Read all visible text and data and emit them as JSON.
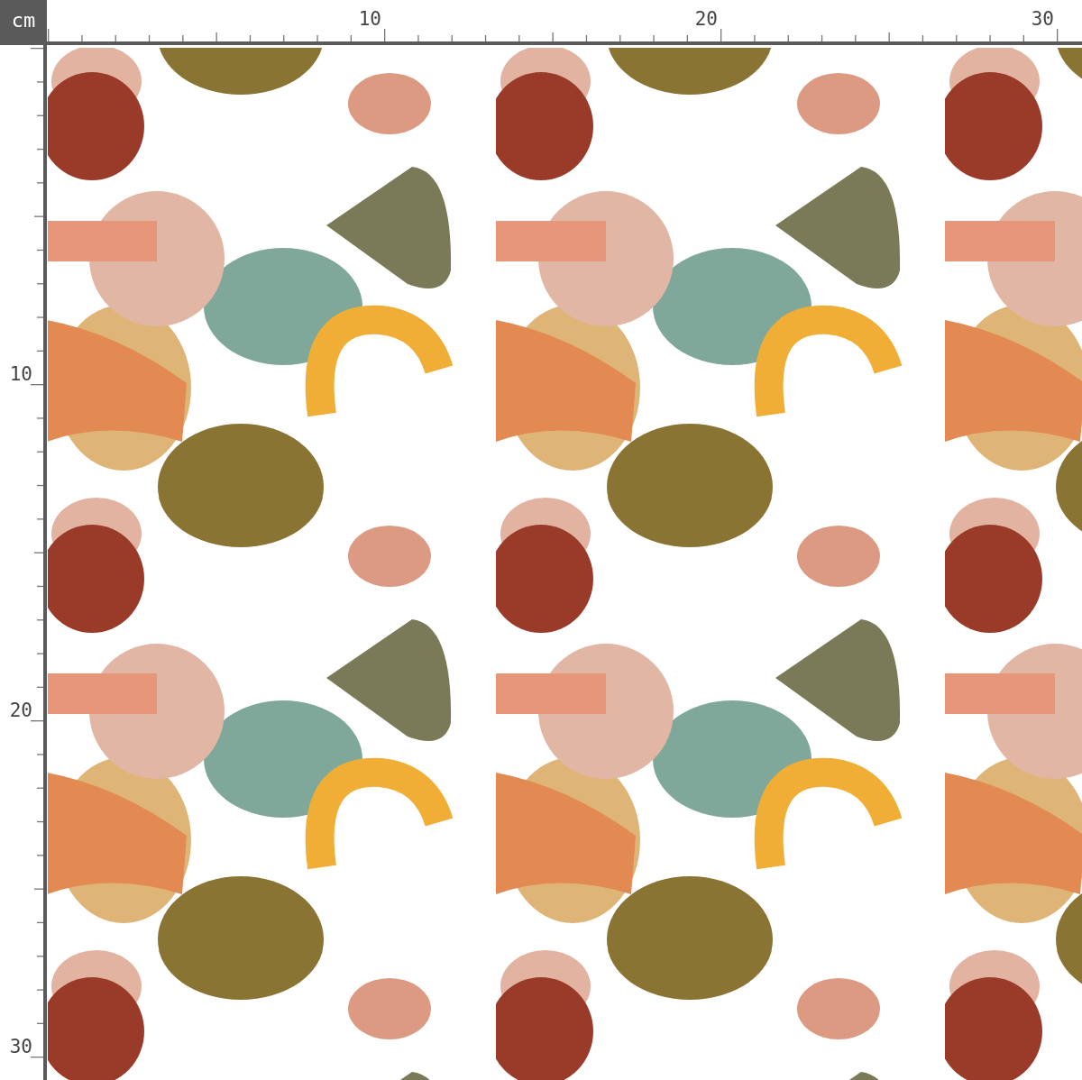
{
  "unit": "cm",
  "top_ruler": {
    "labels": [
      "10",
      "20",
      "30"
    ]
  },
  "left_ruler": {
    "labels": [
      "10",
      "20",
      "30"
    ]
  },
  "fabric": {
    "kind": "pattern"
  }
}
